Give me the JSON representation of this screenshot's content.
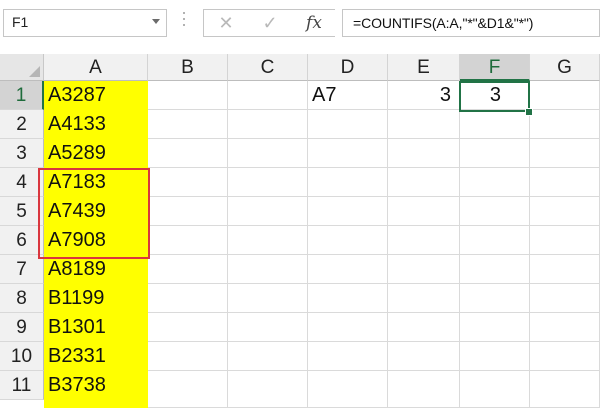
{
  "formula_bar": {
    "name_box": "F1",
    "cancel_icon": "cancel-x-icon",
    "enter_icon": "checkmark-icon",
    "function_label": "fx",
    "formula": "=COUNTIFS(A:A,\"*\"&D1&\"*\")"
  },
  "columns": [
    "A",
    "B",
    "C",
    "D",
    "E",
    "F",
    "G"
  ],
  "active_column": "F",
  "rows": [
    "1",
    "2",
    "3",
    "4",
    "5",
    "6",
    "7",
    "8",
    "9",
    "10",
    "11"
  ],
  "active_row": "1",
  "cells": {
    "A": [
      "A3287",
      "A4133",
      "A5289",
      "A7183",
      "A7439",
      "A7908",
      "A8189",
      "B1199",
      "B1301",
      "B2331",
      "B3738"
    ],
    "D1": "A7",
    "E1": "3",
    "F1": "3"
  },
  "colors": {
    "highlight_fill": "#ffff00",
    "selection_border": "#217346",
    "annotation_border": "#d9363e"
  }
}
